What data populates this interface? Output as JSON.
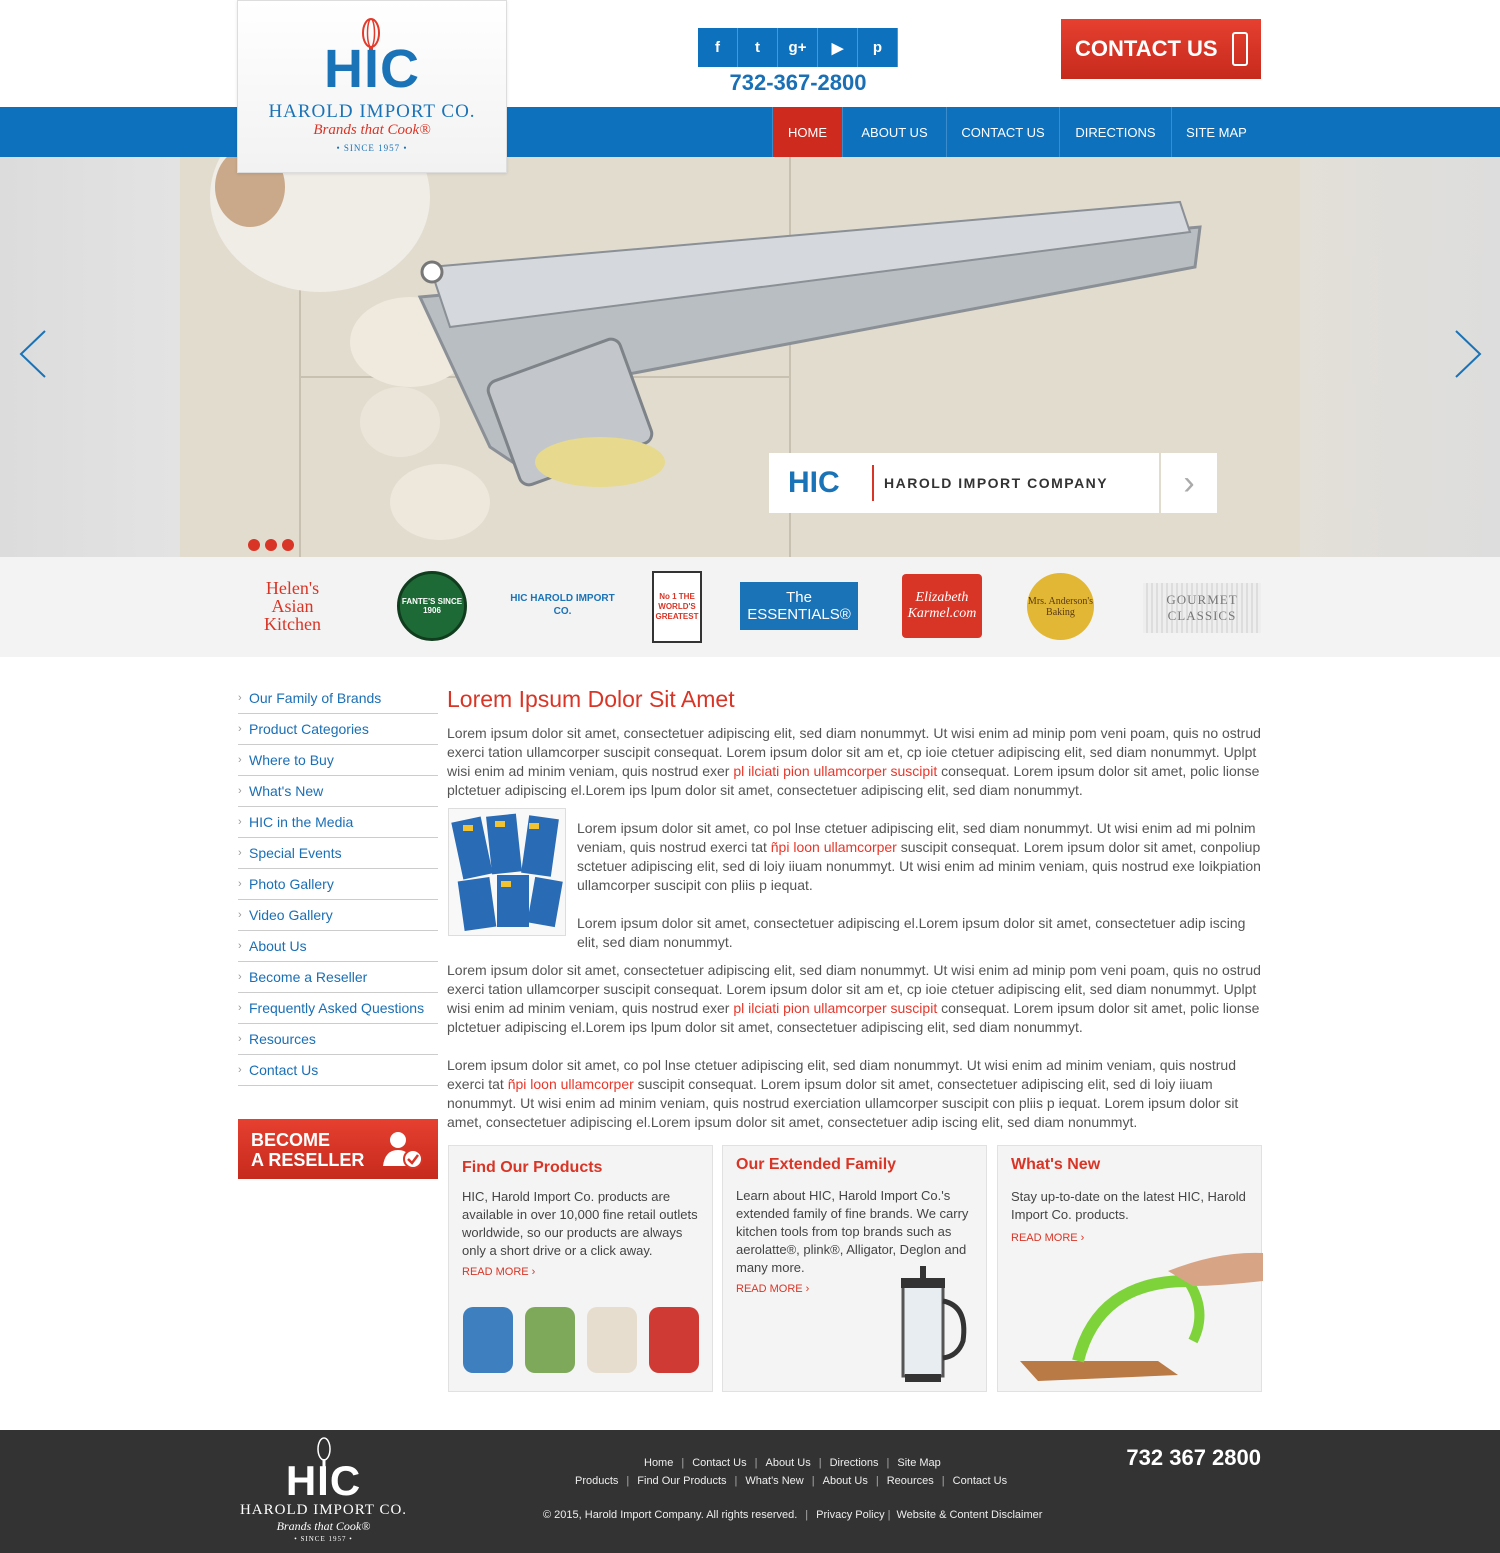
{
  "header": {
    "logo_main": "HIC",
    "logo_company": "HAROLD IMPORT CO.",
    "logo_tagline": "Brands that Cook®",
    "logo_since": "• SINCE 1957 •",
    "phone": "732-367-2800",
    "contact_label": "CONTACT US",
    "social": [
      {
        "name": "facebook-icon",
        "glyph": "f"
      },
      {
        "name": "twitter-icon",
        "glyph": "t"
      },
      {
        "name": "google-plus-icon",
        "glyph": "g+"
      },
      {
        "name": "youtube-icon",
        "glyph": "▶"
      },
      {
        "name": "pinterest-icon",
        "glyph": "p"
      }
    ]
  },
  "nav": {
    "items": [
      "HOME",
      "ABOUT US",
      "CONTACT US",
      "DIRECTIONS",
      "SITE MAP"
    ]
  },
  "hero": {
    "caption_logo": "HIC",
    "caption_text": "HAROLD IMPORT COMPANY"
  },
  "brands": [
    {
      "name": "Helen's Asian Kitchen"
    },
    {
      "name": "FANTE'S SINCE 1906"
    },
    {
      "name": "HIC HAROLD IMPORT CO."
    },
    {
      "name": "No 1 THE WORLD'S GREATEST"
    },
    {
      "name": "The ESSENTIALS®"
    },
    {
      "name": "Elizabeth Karmel.com"
    },
    {
      "name": "Mrs. Anderson's Baking"
    },
    {
      "name": "GOURMET CLASSICS"
    }
  ],
  "sidebar": {
    "items": [
      "Our Family of Brands",
      "Product Categories",
      "Where to Buy",
      "What's New",
      "HIC in the Media",
      "Special Events",
      "Photo Gallery",
      "Video Gallery",
      "About Us",
      "Become a Reseller",
      "Frequently Asked Questions",
      "Resources",
      "Contact Us"
    ],
    "reseller_line1": "BECOME",
    "reseller_line2": "A RESELLER"
  },
  "main": {
    "title": "Lorem Ipsum Dolor Sit Amet",
    "p1_a": "Lorem ipsum dolor sit amet, consectetuer adipiscing elit, sed diam nonummyt. Ut wisi enim ad minip pom veni poam, quis no ostrud exerci tation ullamcorper suscipit consequat. Lorem ipsum dolor sit am et, cp ioie ctetuer adipiscing elit, sed diam nonummyt. Uplpt wisi enim ad minim veniam, quis nostrud exer ",
    "p1_link": "pl ilciati pion ullamcorper suscipit",
    "p1_b": " consequat. Lorem ipsum dolor sit amet, polic lionse plctetuer adipiscing el.Lorem ips lpum dolor sit amet, consectetuer adipiscing elit, sed diam nonummyt.",
    "p2_a": "Lorem ipsum dolor sit amet, co pol lnse ctetuer adipiscing elit, sed diam nonummyt. Ut wisi enim ad mi polnim veniam, quis nostrud exerci tat ",
    "p2_link": "ñpi loon ullamcorper",
    "p2_b": " suscipit consequat. Lorem ipsum dolor sit amet, conpoliup sctetuer adipiscing elit, sed di loiy iiuam nonummyt. Ut wisi enim ad minim veniam, quis nostrud exe loikpiation ullamcorper suscipit con pliis p iequat.",
    "p3": "Lorem ipsum dolor sit amet, consectetuer adipiscing el.Lorem ipsum dolor sit amet, consectetuer adip iscing elit, sed diam nonummyt.",
    "p4_a": "Lorem ipsum dolor sit amet, consectetuer adipiscing elit, sed diam nonummyt. Ut wisi enim ad minip pom veni poam, quis no ostrud exerci tation ullamcorper suscipit consequat. Lorem ipsum dolor sit am et, cp ioie ctetuer adipiscing elit, sed diam nonummyt. Uplpt wisi enim ad minim veniam, quis nostrud exer ",
    "p4_link": "pl ilciati pion ullamcorper suscipit",
    "p4_b": " consequat. Lorem ipsum dolor sit amet, polic lionse plctetuer adipiscing el.Lorem ips lpum dolor sit amet, consectetuer adipiscing elit, sed diam nonummyt.",
    "p5_a": "Lorem ipsum dolor sit amet, co pol lnse ctetuer adipiscing elit, sed diam nonummyt. Ut wisi enim ad minim veniam, quis nostrud exerci tat ",
    "p5_link": "ñpi loon ullamcorper",
    "p5_b": " suscipit consequat. Lorem ipsum dolor sit amet, consectetuer adipiscing elit, sed di loiy iiuam nonummyt. Ut wisi enim ad minim veniam, quis nostrud exerciation ullamcorper suscipit con pliis p iequat. Lorem ipsum dolor sit amet, consectetuer adipiscing el.Lorem ipsum dolor sit amet, consectetuer adip iscing elit, sed diam nonummyt."
  },
  "cards": [
    {
      "title": "Find Our Products",
      "text": "HIC, Harold Import Co. products are available in over 10,000 fine retail outlets worldwide, so our products are always only a short drive or a click away.",
      "more": "READ MORE"
    },
    {
      "title": "Our Extended Family",
      "text": "Learn about HIC, Harold Import Co.'s extended family of fine brands.  We carry kitchen tools from top brands such as aerolatte®, plink®, Alligator, Deglon and many more.",
      "more": "READ MORE"
    },
    {
      "title": "What's New",
      "text": "Stay up-to-date on the latest HIC, Harold Import Co. products.",
      "more": "READ MORE"
    }
  ],
  "footer": {
    "logo_main": "HIC",
    "logo_company": "HAROLD IMPORT CO.",
    "logo_tagline": "Brands that Cook®",
    "logo_since": "• SINCE 1957 •",
    "links_row1": [
      "Home",
      "Contact Us",
      "About Us",
      "Directions",
      "Site Map"
    ],
    "links_row2": [
      "Products",
      "Find Our Products",
      "What's New",
      "About Us",
      "Reources",
      "Contact Us"
    ],
    "copyright": "© 2015, Harold Import Company. All rights reserved.",
    "privacy": "Privacy Policy",
    "disclaimer": "Website & Content Disclaimer",
    "phone": "732 367 2800"
  },
  "colors": {
    "blue": "#0e71bd",
    "red": "#d93526",
    "footer": "#333333"
  }
}
